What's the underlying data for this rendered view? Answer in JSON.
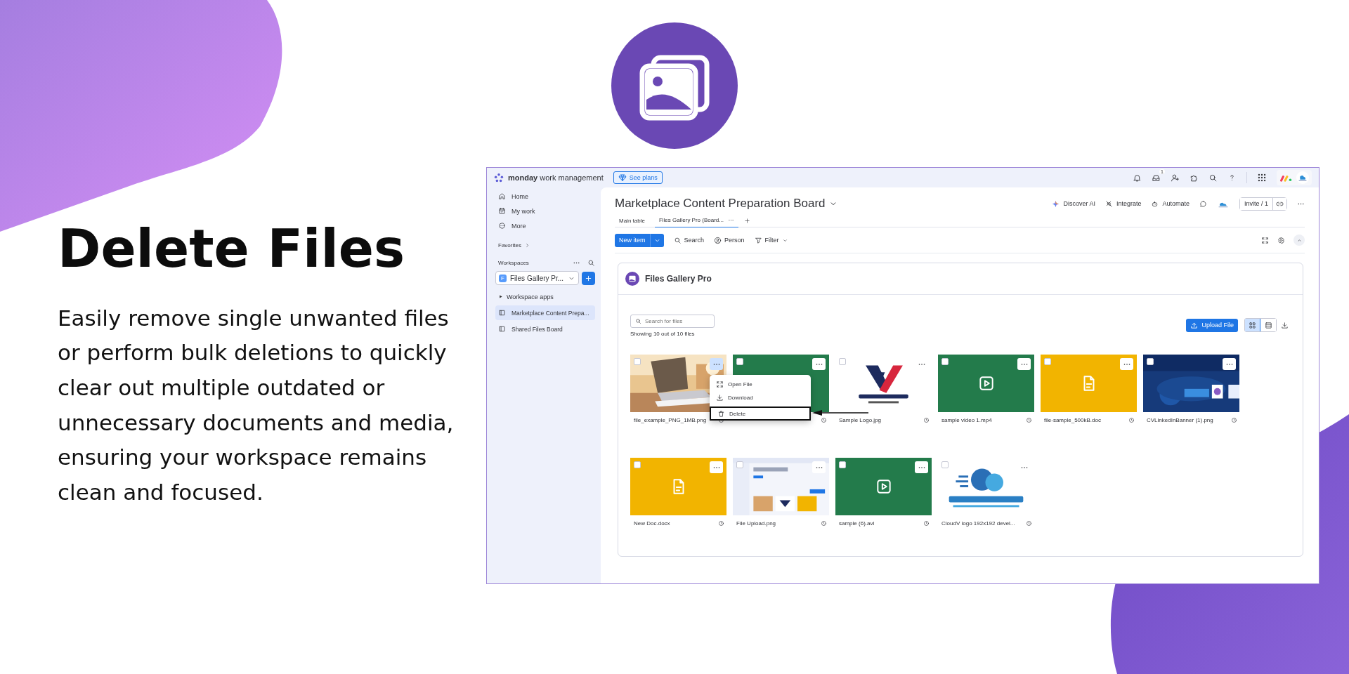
{
  "headline": "Delete Files",
  "description": "Easily remove single unwanted files or perform bulk deletions to quickly clear out multiple outdated or unnecessary documents and media, ensuring your workspace remains clean and focused.",
  "topbar": {
    "brand_bold": "monday",
    "brand_rest": "work management",
    "plans_button": "See plans",
    "inbox_badge": "1"
  },
  "sidebar": {
    "nav": [
      {
        "label": "Home"
      },
      {
        "label": "My work"
      },
      {
        "label": "More"
      }
    ],
    "favorites": "Favorites",
    "workspaces": "Workspaces",
    "workspace_select": {
      "initial": "F",
      "value": "Files Gallery Pr..."
    },
    "workspace_apps": "Workspace apps",
    "boards": [
      {
        "label": "Marketplace Content Prepa...",
        "selected": true
      },
      {
        "label": "Shared Files Board",
        "selected": false
      }
    ]
  },
  "board": {
    "title": "Marketplace Content Preparation Board",
    "actions": [
      {
        "label": "Discover AI"
      },
      {
        "label": "Integrate"
      },
      {
        "label": "Automate"
      }
    ],
    "invite": "Invite / 1",
    "tabs": [
      {
        "label": "Main table",
        "selected": false
      },
      {
        "label": "Files Gallery Pro (Board...",
        "selected": true
      }
    ],
    "new_item": "New item",
    "tools": [
      {
        "label": "Search"
      },
      {
        "label": "Person"
      },
      {
        "label": "Filter"
      }
    ]
  },
  "gallery": {
    "title": "Files Gallery Pro",
    "search_placeholder": "Search for files",
    "count_text": "Showing 10 out of 10 files",
    "upload_button": "Upload File",
    "views": [
      {
        "selected": true
      },
      {
        "selected": false
      }
    ],
    "files": [
      {
        "name": "file_example_PNG_1MB.png",
        "kind": "picture",
        "checked": false,
        "menu_open": true
      },
      {
        "kind": "video",
        "checked": false,
        "menu_open": false
      },
      {
        "name": "Sample Logo.jpg",
        "kind": "logo",
        "checked": false,
        "menu_open": false
      },
      {
        "name": "sample video 1.mp4",
        "kind": "video",
        "checked": false,
        "menu_open": false
      },
      {
        "name": "file-sample_500kB.doc",
        "kind": "doc",
        "checked": false,
        "menu_open": false
      },
      {
        "name": "CVLinkedInBanner (1).png",
        "kind": "picture",
        "checked": false,
        "menu_open": false
      },
      {
        "name": "New Doc.docx",
        "kind": "doc",
        "checked": false,
        "menu_open": false
      },
      {
        "name": "File Upload.png",
        "kind": "picture",
        "checked": false,
        "menu_open": false
      },
      {
        "name": "sample (6).avi",
        "kind": "video",
        "checked": false,
        "menu_open": false
      },
      {
        "name": "CloudV logo 192x192 devel...",
        "kind": "logo",
        "checked": false,
        "menu_open": false
      }
    ],
    "context_menu": [
      {
        "label": "Open File",
        "annotated": false
      },
      {
        "label": "Download",
        "annotated": false
      },
      {
        "label": "Delete",
        "annotated": true
      }
    ]
  }
}
